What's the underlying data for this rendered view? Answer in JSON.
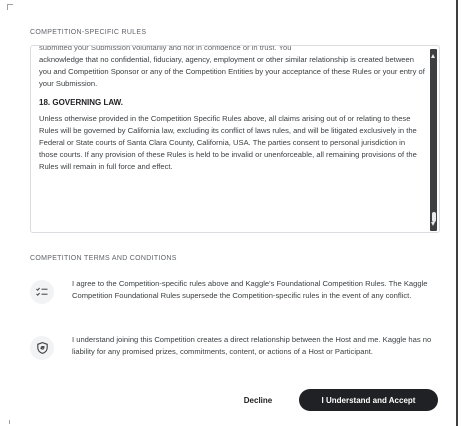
{
  "rules_section": {
    "heading": "COMPETITION-SPECIFIC RULES",
    "cut_line": "submitted your Submission voluntarily and not in confidence or in trust. You",
    "paragraph_1": "acknowledge that no confidential, fiduciary, agency, employment or other similar relationship is created between you and Competition Sponsor or any of the Competition Entities by your acceptance of these Rules or your entry of your Submission.",
    "governing_law_title": "18. GOVERNING LAW.",
    "governing_law_text": "Unless otherwise provided in the Competition Specific Rules above, all claims arising out of or relating to these Rules will be governed by California law, excluding its conflict of laws rules, and will be litigated exclusively in the Federal or State courts of Santa Clara County, California, USA. The parties consent to personal jurisdiction in those courts. If any provision of these Rules is held to be invalid or unenforceable, all remaining provisions of the Rules will remain in full force and effect."
  },
  "terms_section": {
    "heading": "COMPETITION TERMS AND CONDITIONS",
    "items": [
      {
        "icon": "checklist-icon",
        "text": "I agree to the Competition-specific rules above and Kaggle's Foundational Competition Rules. The Kaggle Competition Foundational Rules supersede the Competition-specific rules in the event of any conflict."
      },
      {
        "icon": "shield-icon",
        "text": "I understand joining this Competition creates a direct relationship between the Host and me. Kaggle has no liability for any promised prizes, commitments, content, or actions of a Host or Participant."
      }
    ]
  },
  "actions": {
    "decline_label": "Decline",
    "accept_label": "I Understand and Accept"
  },
  "colors": {
    "accept_bg": "#202124",
    "scrollbar": "#3c4043",
    "icon_bg": "#f1f3f4"
  }
}
